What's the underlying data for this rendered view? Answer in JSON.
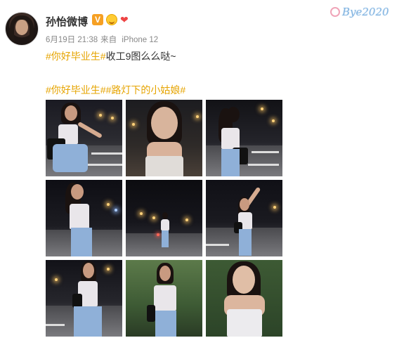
{
  "post": {
    "username": "孙怡微博",
    "badges": [
      "verified-v-icon",
      "face-emoji-icon",
      "heart-icon"
    ],
    "date": "6月19日 21:38",
    "source_prefix": "来自",
    "source": "iPhone 12",
    "tag1": "#你好毕业生#",
    "text1": "收工9图么么哒~",
    "tag2": "#你好毕业生#",
    "tag3": "#路灯下的小姑娘#",
    "photo_count": 9
  },
  "watermark": {
    "text": "Bye2020"
  },
  "colors": {
    "tag": "#e6a400",
    "meta_text": "#888888",
    "body_text": "#333333",
    "watermark": "#7fb2e0"
  },
  "photos": [
    {
      "name": "photo-1",
      "scene": "night crosswalk, crouching, black bag"
    },
    {
      "name": "photo-2",
      "scene": "close-up portrait, street lights"
    },
    {
      "name": "photo-3",
      "scene": "back view, ponytail, black bag"
    },
    {
      "name": "photo-4",
      "scene": "street at night, side view"
    },
    {
      "name": "photo-5",
      "scene": "distant street, standing"
    },
    {
      "name": "photo-6",
      "scene": "arm raised, street light"
    },
    {
      "name": "photo-7",
      "scene": "standing by road, black bag"
    },
    {
      "name": "photo-8",
      "scene": "greenery background, black bag"
    },
    {
      "name": "photo-9",
      "scene": "close-up portrait, white top"
    }
  ]
}
